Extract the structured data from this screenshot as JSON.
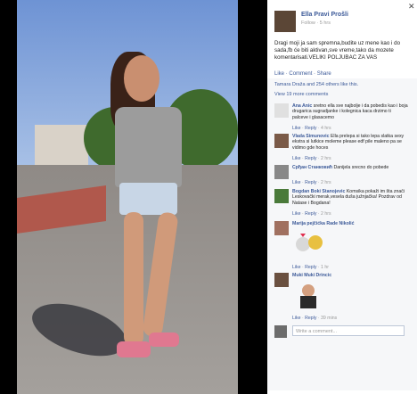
{
  "header": {
    "name": "Ella Pravi Prošli",
    "meta": "Follow · 5 hrs"
  },
  "post": {
    "text": "Dragi moji ja sam spremna,budite uz mene kao i do sada,fb će biti aktivan,sve vreme,tako da mozete komentarisati.VELIKI POLJUBAC ZA VAS"
  },
  "actions": {
    "like": "Like",
    "comment": "Comment",
    "share": "Share"
  },
  "likes": "Tamara Draža and 254 others like this.",
  "view_more": "View 19 more comments",
  "comments": [
    {
      "name": "Ana Anic",
      "text": "sretno ella sve najbolje i da pobedis kao i boja drugarica sugradjanke i kolegnica kaca drzimo ti palceve i glasacemo",
      "like": "Like",
      "reply": "Reply",
      "time": "4 hrs"
    },
    {
      "name": "Vlada Simunovic",
      "text": "Ella prelepa si tako lepa slatka sexy ekstra si lutkice moleme please edf pile maleno pa se vidimo gde hoces",
      "like": "Like",
      "reply": "Reply",
      "time": "2 hrs"
    },
    {
      "name": "Срђан Станковић",
      "text": "Danijela srecno do pobede",
      "like": "Like",
      "reply": "Reply",
      "time": "2 hrs"
    },
    {
      "name": "Bogdan Boki Stanojevic",
      "text": "Komsika pokaži im šta znači Leskovački merak,vesela duša južnjačka! Pozdrav od Natase i Bogdana!",
      "like": "Like",
      "reply": "Reply",
      "time": "2 hrs"
    },
    {
      "name": "Marija pejčićka",
      "text": "Rade Nikolić",
      "like": "Like",
      "reply": "Reply",
      "time": "1 hr"
    },
    {
      "name": "Muki Muki Drincic",
      "text": "",
      "like": "Like",
      "reply": "Reply",
      "time": "39 mins"
    }
  ],
  "write": {
    "placeholder": "Write a comment..."
  },
  "colors": {
    "link": "#3b5998",
    "panel": "#ffffff",
    "photo_bg": "#000000"
  }
}
